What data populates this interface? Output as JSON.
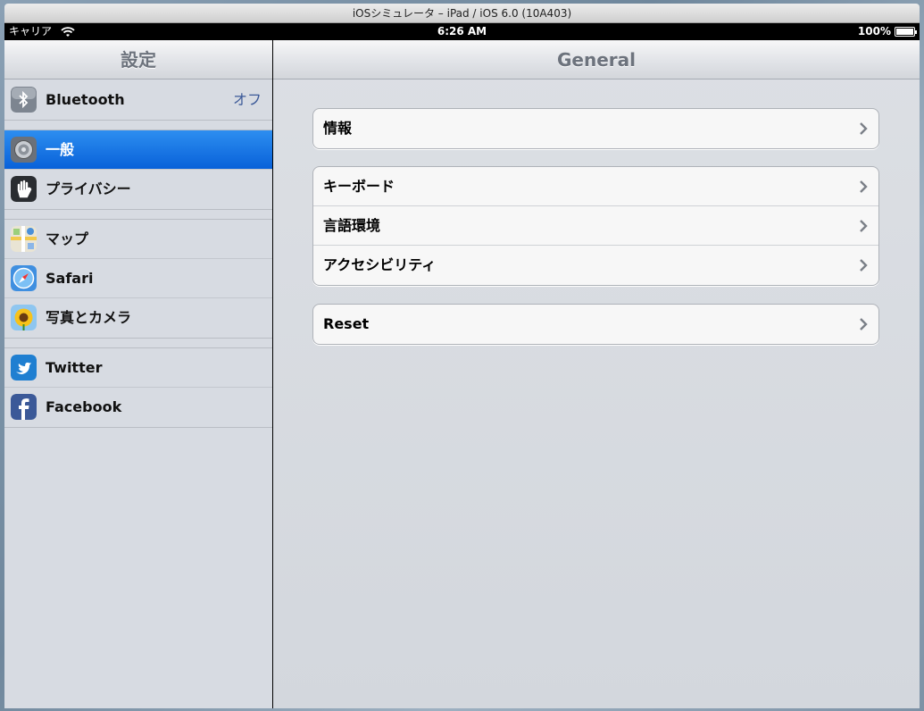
{
  "window": {
    "title": "iOSシミュレータ – iPad / iOS 6.0 (10A403)"
  },
  "statusbar": {
    "carrier": "キャリア",
    "time": "6:26 AM",
    "battery": "100%"
  },
  "master": {
    "title": "設定",
    "groups": [
      [
        {
          "label": "Bluetooth",
          "value": "オフ",
          "icon": "bluetooth-icon"
        }
      ],
      [
        {
          "label": "一般",
          "icon": "gear-icon",
          "selected": true
        },
        {
          "label": "プライバシー",
          "icon": "hand-icon"
        }
      ],
      [
        {
          "label": "マップ",
          "icon": "maps-icon"
        },
        {
          "label": "Safari",
          "icon": "compass-icon"
        },
        {
          "label": "写真とカメラ",
          "icon": "sunflower-icon"
        }
      ],
      [
        {
          "label": "Twitter",
          "icon": "twitter-bird-icon"
        },
        {
          "label": "Facebook",
          "icon": "facebook-f-icon"
        }
      ]
    ]
  },
  "detail": {
    "title": "General",
    "groups": [
      [
        {
          "label": "情報"
        }
      ],
      [
        {
          "label": "キーボード"
        },
        {
          "label": "言語環境"
        },
        {
          "label": "アクセシビリティ"
        }
      ],
      [
        {
          "label": "Reset"
        }
      ]
    ]
  },
  "colors": {
    "selected_row": "#0a66dc",
    "value_text": "#3b5998",
    "nav_title": "#6d737d"
  }
}
